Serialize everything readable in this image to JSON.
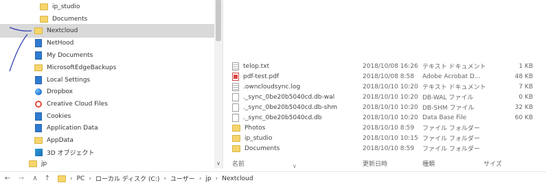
{
  "tree": {
    "items": [
      {
        "label": "ip_studio",
        "icon": "folder-icon"
      },
      {
        "label": "Documents",
        "icon": "folder-icon"
      },
      {
        "label": "Nextcloud",
        "icon": "folder-icon"
      },
      {
        "label": "NetHood",
        "icon": "doc-icon"
      },
      {
        "label": "My Documents",
        "icon": "doc-icon"
      },
      {
        "label": "MicrosoftEdgeBackups",
        "icon": "folder-icon"
      },
      {
        "label": "Local Settings",
        "icon": "doc-icon"
      },
      {
        "label": "Dropbox",
        "icon": "dropbox-icon"
      },
      {
        "label": "Creative Cloud Files",
        "icon": "creative-cloud-icon"
      },
      {
        "label": "Cookies",
        "icon": "doc-icon"
      },
      {
        "label": "Application Data",
        "icon": "doc-icon"
      },
      {
        "label": "AppData",
        "icon": "folder-icon"
      },
      {
        "label": "3D オブジェクト",
        "icon": "3d-objects-icon"
      },
      {
        "label": "jp",
        "icon": "folder-icon"
      }
    ]
  },
  "files": [
    {
      "name": "telop.txt",
      "date": "2018/10/08 16:26",
      "type": "テキスト ドキュメント",
      "size": "1 KB",
      "icon": "text-file-icon"
    },
    {
      "name": "pdf-test.pdf",
      "date": "2018/10/08 8:58",
      "type": "Adobe Acrobat D...",
      "size": "48 KB",
      "icon": "pdf-file-icon"
    },
    {
      "name": ".owncloudsync.log",
      "date": "2018/10/10 10:20",
      "type": "テキスト ドキュメント",
      "size": "7 KB",
      "icon": "text-file-icon"
    },
    {
      "name": "._sync_0be20b5040cd.db-wal",
      "date": "2018/10/10 10:20",
      "type": "DB-WAL ファイル",
      "size": "0 KB",
      "icon": "blank-file-icon"
    },
    {
      "name": "._sync_0be20b5040cd.db-shm",
      "date": "2018/10/10 10:20",
      "type": "DB-SHM ファイル",
      "size": "32 KB",
      "icon": "blank-file-icon"
    },
    {
      "name": "._sync_0be20b5040cd.db",
      "date": "2018/10/10 10:20",
      "type": "Data Base File",
      "size": "60 KB",
      "icon": "blank-file-icon"
    },
    {
      "name": "Photos",
      "date": "2018/10/10 8:59",
      "type": "ファイル フォルダー",
      "size": "",
      "icon": "folder-icon"
    },
    {
      "name": "ip_studio",
      "date": "2018/10/10 10:15",
      "type": "ファイル フォルダー",
      "size": "",
      "icon": "folder-icon"
    },
    {
      "name": "Documents",
      "date": "2018/10/10 8:59",
      "type": "ファイル フォルダー",
      "size": "",
      "icon": "folder-icon"
    }
  ],
  "columns": {
    "name": "名前",
    "date": "更新日時",
    "type": "種類",
    "size": "サイズ"
  },
  "address": {
    "nav_back": "←",
    "nav_forward": "→",
    "nav_up_recent": "∧",
    "nav_up": "↑",
    "crumbs": [
      "PC",
      "ローカル ディスク (C:)",
      "ユーザー",
      "jp",
      "Nextcloud"
    ],
    "separator": "›"
  },
  "scroll": {
    "up": "▲",
    "down": "∨"
  },
  "sort_indicator": "∨"
}
